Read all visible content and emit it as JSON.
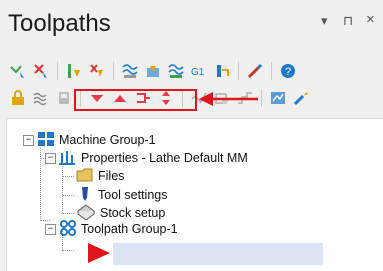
{
  "panel": {
    "title": "Toolpaths",
    "controls": {
      "dropdown": "▾",
      "pin": "⊓",
      "close": "×"
    }
  },
  "tree": {
    "machine_group": "Machine Group-1",
    "properties": "Properties - Lathe Default MM",
    "files": "Files",
    "tool_settings": "Tool settings",
    "stock_setup": "Stock setup",
    "toolpath_group": "Toolpath Group-1",
    "expand_minus": "−"
  },
  "colors": {
    "accent_red": "#e0141b",
    "selection": "#dbe4f3",
    "tree_blue": "#1e78c8"
  }
}
